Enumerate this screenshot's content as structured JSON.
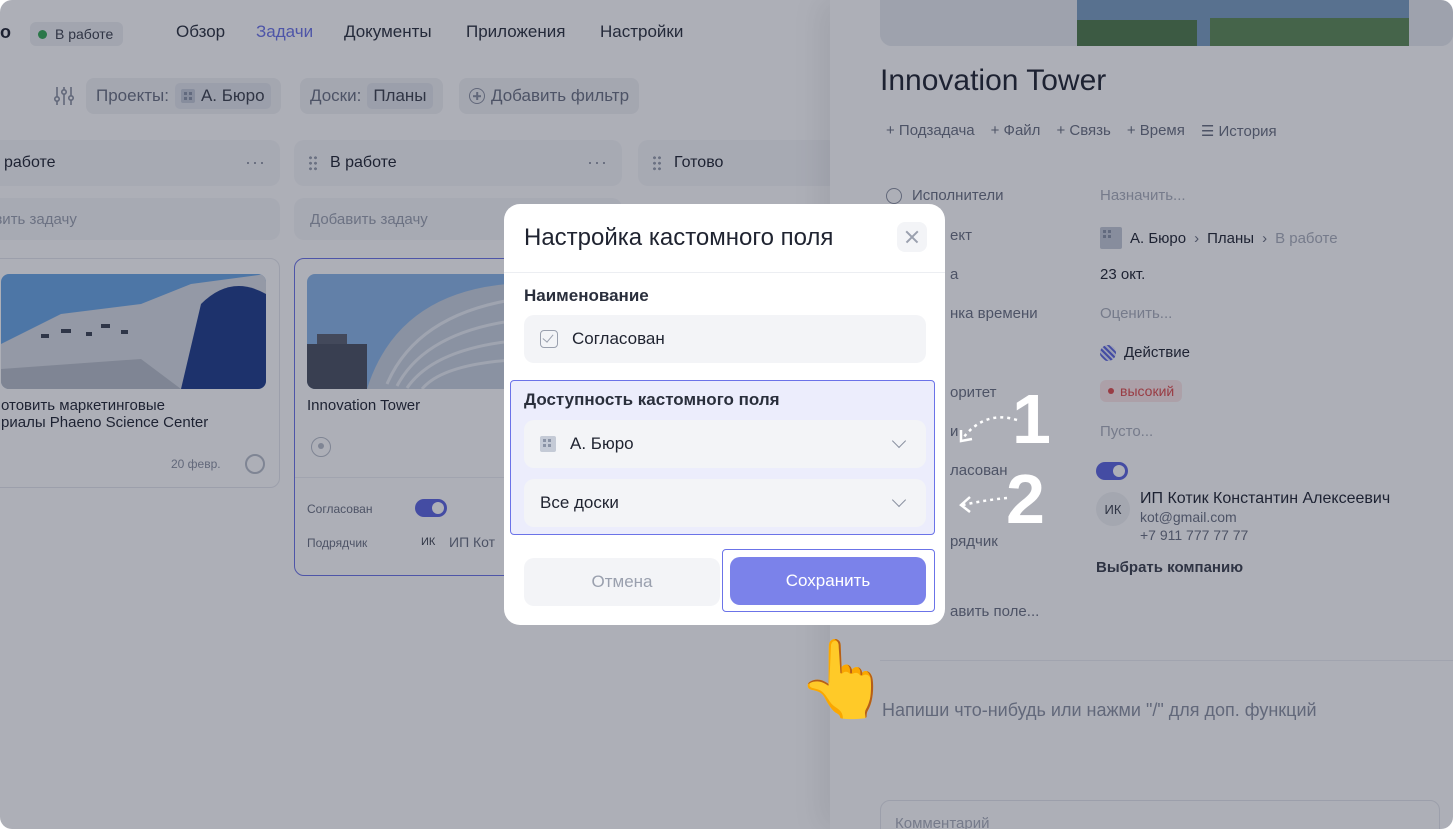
{
  "nav": {
    "brand_tail": "о",
    "status_label": "В работе",
    "tabs": [
      "Обзор",
      "Задачи",
      "Документы",
      "Приложения",
      "Настройки"
    ],
    "active_tab": "Задачи"
  },
  "filters": {
    "projects_label": "Проекты:",
    "projects_value": "А. Бюро",
    "boards_label": "Доски:",
    "boards_value": "Планы",
    "add_filter": "Добавить фильтр"
  },
  "columns": [
    {
      "title": "работе",
      "add_task": "авить задачу"
    },
    {
      "title": "В работе",
      "add_task": "Добавить задачу"
    },
    {
      "title": "Готово"
    }
  ],
  "column_menu": "···",
  "cards": {
    "left": {
      "title_line1": "отовить маркетинговые",
      "title_line2": "риалы Phaeno Science Center",
      "date": "20 февр."
    },
    "middle": {
      "title": "Innovation Tower",
      "field1_label": "Согласован",
      "field2_label": "Подрядчик",
      "field2_initials": "ИК",
      "field2_value": "ИП Кот"
    }
  },
  "detail": {
    "title": "Innovation Tower",
    "actions": [
      "+ Подзадача",
      "+ Файл",
      "+ Связь",
      "+ Время",
      "☰ История"
    ],
    "rows": {
      "assignees_label": "Исполнители",
      "assignees_value": "Назначить...",
      "project_label": "ект",
      "project_path": [
        "А. Бюро",
        "Планы",
        "В работе"
      ],
      "date_label": "а",
      "date_value": "23 окт.",
      "estimate_label": "нка времени",
      "estimate_value": "Оценить...",
      "type_value": "Действие",
      "priority_label": "оритет",
      "priority_value": "высокий",
      "empty_label": "и",
      "empty_value": "Пусто...",
      "approved_label": "ласован",
      "contractor_label": "рядчик",
      "contractor_initials": "ИК",
      "contractor_name": "ИП Котик Константин Алексеевич",
      "contractor_email": "kot@gmail.com",
      "contractor_phone": "+7 911 777 77 77",
      "choose_company": "Выбрать компанию",
      "add_field": "авить поле..."
    },
    "editor_placeholder": "Напиши что-нибудь или нажми \"/\" для доп. функций",
    "comment_placeholder": "Комментарий"
  },
  "modal": {
    "title": "Настройка кастомного поля",
    "name_label": "Наименование",
    "name_value": "Согласован",
    "availability_label": "Доступность кастомного поля",
    "project_select": "А. Бюро",
    "board_select": "Все доски",
    "cancel_label": "Отмена",
    "save_label": "Сохранить"
  },
  "annotations": [
    "1",
    "2"
  ],
  "pointer_emoji": "👆",
  "colors": {
    "accent": "#6b73e8",
    "save_button": "#7b82ea",
    "priority_red": "#e04b4b",
    "status_green": "#34a853",
    "overlay": "rgba(28,33,56,0.36)"
  }
}
